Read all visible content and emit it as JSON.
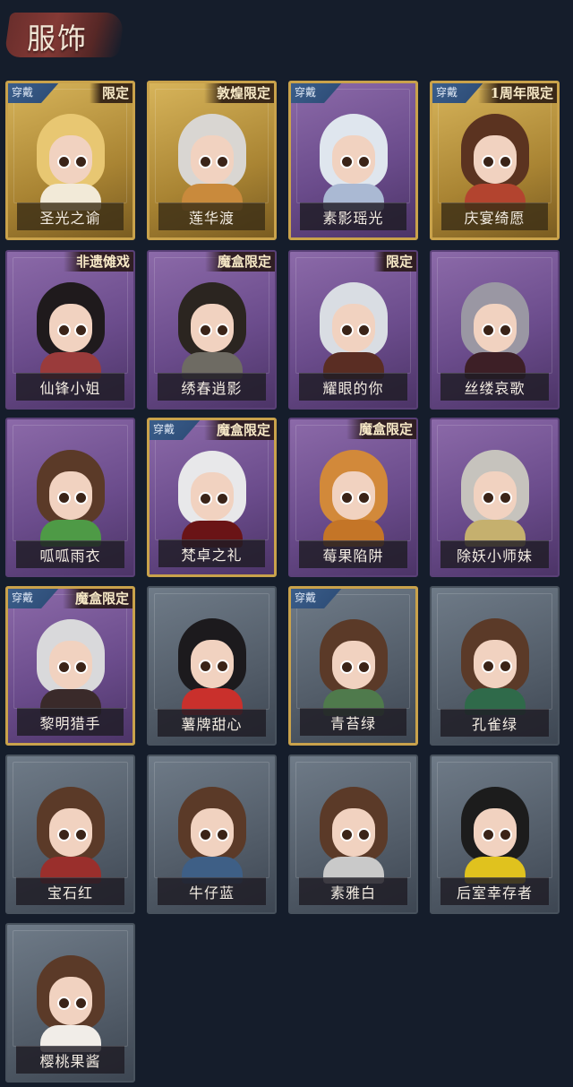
{
  "page": {
    "title": "服饰"
  },
  "equipped_label": "穿戴",
  "costumes": [
    {
      "name": "圣光之谕",
      "tag": "限定",
      "equipped": true,
      "frame": "gold",
      "hair": "#e8c772",
      "outfit": "#f2ead8"
    },
    {
      "name": "莲华渡",
      "tag": "敦煌限定",
      "equipped": false,
      "frame": "gold",
      "hair": "#d9d6d2",
      "outfit": "#c98a3c"
    },
    {
      "name": "素影瑶光",
      "tag": "",
      "equipped": true,
      "frame": "purple",
      "hair": "#dfe6ee",
      "outfit": "#aab9d3"
    },
    {
      "name": "庆宴绮愿",
      "tag": "1周年限定",
      "equipped": true,
      "frame": "gold",
      "hair": "#5b3320",
      "outfit": "#b3442f"
    },
    {
      "name": "仙锋小姐",
      "tag": "非遗傩戏",
      "equipped": false,
      "frame": "purple",
      "hair": "#1f1a1c",
      "outfit": "#9a3b3b"
    },
    {
      "name": "绣春逍影",
      "tag": "魔盒限定",
      "equipped": false,
      "frame": "purple",
      "hair": "#2b2520",
      "outfit": "#6e6b63"
    },
    {
      "name": "耀眼的你",
      "tag": "限定",
      "equipped": false,
      "frame": "purple",
      "hair": "#d9dde3",
      "outfit": "#5a2d23"
    },
    {
      "name": "丝缕哀歌",
      "tag": "",
      "equipped": false,
      "frame": "purple",
      "hair": "#9a97a3",
      "outfit": "#3d1f26"
    },
    {
      "name": "呱呱雨衣",
      "tag": "",
      "equipped": false,
      "frame": "purple",
      "hair": "#5b3a28",
      "outfit": "#4e9a46"
    },
    {
      "name": "梵卓之礼",
      "tag": "魔盒限定",
      "equipped": true,
      "frame": "purple",
      "hair": "#e8e8ea",
      "outfit": "#6a1416"
    },
    {
      "name": "莓果陷阱",
      "tag": "魔盒限定",
      "equipped": false,
      "frame": "purple",
      "hair": "#d2893a",
      "outfit": "#c47527"
    },
    {
      "name": "除妖小师妹",
      "tag": "",
      "equipped": false,
      "frame": "purple",
      "hair": "#c6c3bd",
      "outfit": "#c5b06e"
    },
    {
      "name": "黎明猎手",
      "tag": "魔盒限定",
      "equipped": true,
      "frame": "purple",
      "hair": "#d9d9db",
      "outfit": "#3a2a2a"
    },
    {
      "name": "薯牌甜心",
      "tag": "",
      "equipped": false,
      "frame": "grey",
      "hair": "#1c1a1d",
      "outfit": "#c9302c"
    },
    {
      "name": "青苔绿",
      "tag": "",
      "equipped": true,
      "frame": "grey",
      "hair": "#5b3a28",
      "outfit": "#4f7a4c"
    },
    {
      "name": "孔雀绿",
      "tag": "",
      "equipped": false,
      "frame": "grey",
      "hair": "#5b3a28",
      "outfit": "#2f6a4a"
    },
    {
      "name": "宝石红",
      "tag": "",
      "equipped": false,
      "frame": "grey",
      "hair": "#5b3a28",
      "outfit": "#9a2f2c"
    },
    {
      "name": "牛仔蓝",
      "tag": "",
      "equipped": false,
      "frame": "grey",
      "hair": "#5b3a28",
      "outfit": "#3e5f86"
    },
    {
      "name": "素雅白",
      "tag": "",
      "equipped": false,
      "frame": "grey",
      "hair": "#5b3a28",
      "outfit": "#c9c9c9"
    },
    {
      "name": "后室幸存者",
      "tag": "",
      "equipped": false,
      "frame": "grey",
      "hair": "#1c1c1c",
      "outfit": "#e0c21e"
    },
    {
      "name": "樱桃果酱",
      "tag": "",
      "equipped": false,
      "frame": "grey",
      "hair": "#5b3a28",
      "outfit": "#f1ede8"
    }
  ]
}
